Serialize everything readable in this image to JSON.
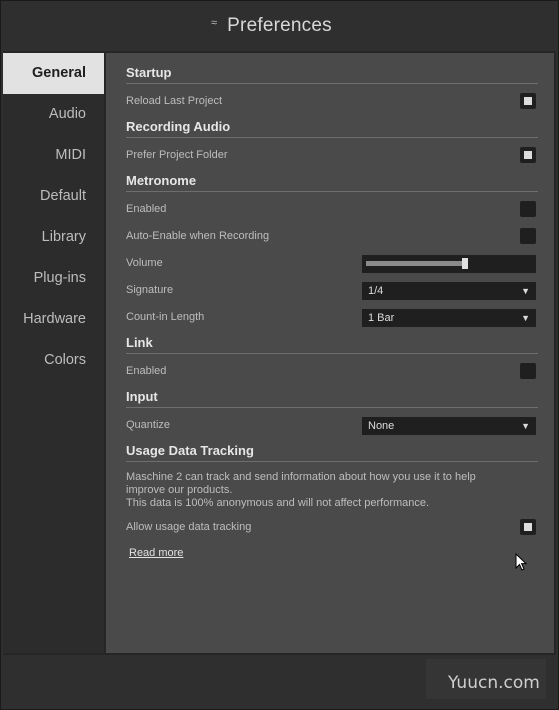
{
  "window": {
    "title": "Preferences"
  },
  "sidebar": {
    "items": [
      {
        "label": "General",
        "active": true
      },
      {
        "label": "Audio"
      },
      {
        "label": "MIDI"
      },
      {
        "label": "Default"
      },
      {
        "label": "Library"
      },
      {
        "label": "Plug-ins"
      },
      {
        "label": "Hardware"
      },
      {
        "label": "Colors"
      }
    ]
  },
  "startup": {
    "title": "Startup",
    "reload_last_project": {
      "label": "Reload Last Project",
      "checked": true
    }
  },
  "recording_audio": {
    "title": "Recording Audio",
    "prefer_project_folder": {
      "label": "Prefer Project Folder",
      "checked": true
    }
  },
  "metronome": {
    "title": "Metronome",
    "enabled": {
      "label": "Enabled",
      "checked": false
    },
    "auto_enable": {
      "label": "Auto-Enable when Recording",
      "checked": false
    },
    "volume": {
      "label": "Volume",
      "value": 0.6
    },
    "signature": {
      "label": "Signature",
      "value": "1/4"
    },
    "count_in": {
      "label": "Count-in Length",
      "value": "1 Bar"
    }
  },
  "link": {
    "title": "Link",
    "enabled": {
      "label": "Enabled",
      "checked": false
    }
  },
  "input": {
    "title": "Input",
    "quantize": {
      "label": "Quantize",
      "value": "None"
    }
  },
  "usage": {
    "title": "Usage Data Tracking",
    "desc_line1": "Maschine 2 can track and send information about how you use it to help",
    "desc_line2": "improve our products.",
    "desc_line3": "This data is 100% anonymous and will not affect performance.",
    "allow": {
      "label": "Allow usage data tracking",
      "checked": true
    },
    "read_more": "Read more"
  },
  "watermark": "Yuucn.com"
}
